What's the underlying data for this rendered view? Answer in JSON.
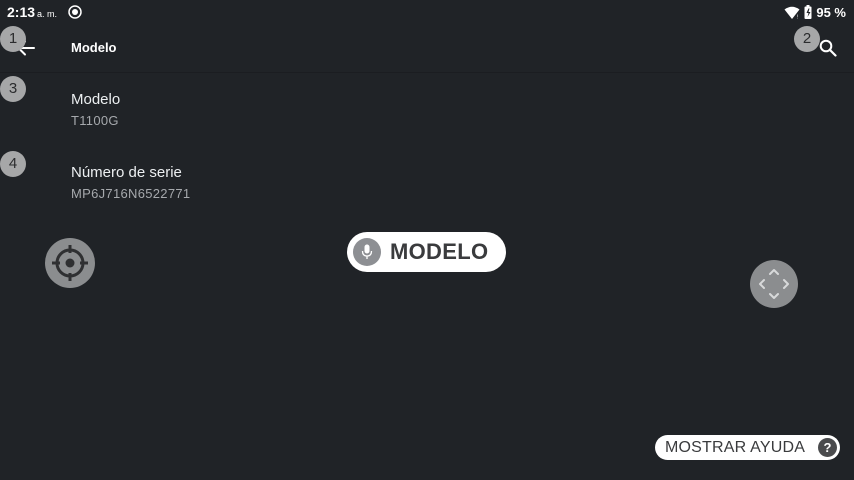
{
  "status_bar": {
    "time": "2:13",
    "ampm": "a. m.",
    "battery": "95 %",
    "icons": [
      "notification-dot-icon",
      "wifi-icon",
      "battery-icon"
    ]
  },
  "app_bar": {
    "title": "Modelo",
    "back_icon": "arrow-left-icon",
    "search_icon": "search-icon"
  },
  "badges": [
    "1",
    "2",
    "3",
    "4"
  ],
  "preferences": [
    {
      "title": "Modelo",
      "summary": "T1100G"
    },
    {
      "title": "Número de serie",
      "summary": "MP6J716N6522771"
    }
  ],
  "voice": {
    "label": "MODELO",
    "icon": "mic-icon"
  },
  "controls": {
    "crosshair_icon": "crosshair-icon",
    "dpad_icon": "dpad-icon"
  },
  "help": {
    "label": "MOSTRAR AYUDA",
    "icon_text": "?"
  },
  "colors": {
    "background": "#202327",
    "badge": "#a6a7a8",
    "pill": "#ffffff"
  }
}
